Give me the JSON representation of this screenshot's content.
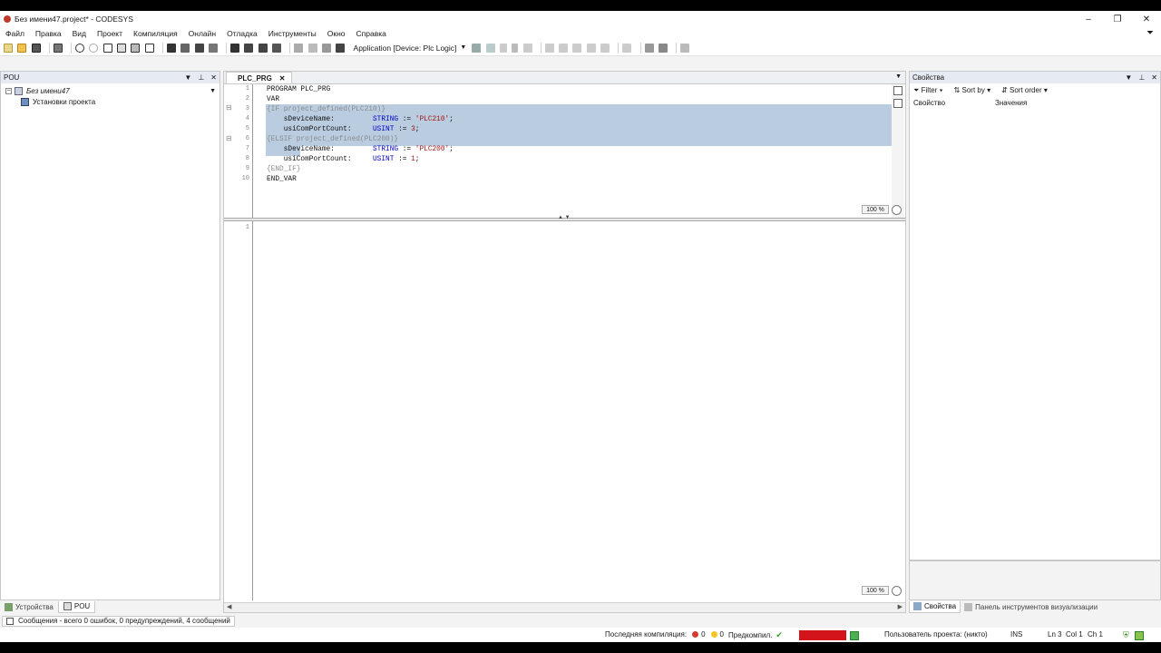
{
  "window": {
    "title": "Без имени47.project* - CODESYS",
    "controls": [
      "–",
      "❐",
      "✕"
    ]
  },
  "menu": [
    "Файл",
    "Правка",
    "Вид",
    "Проект",
    "Компиляция",
    "Онлайн",
    "Отладка",
    "Инструменты",
    "Окно",
    "Справка"
  ],
  "toolbar": {
    "application": "Application [Device: Plc Logic]"
  },
  "pou_panel": {
    "title": "POU",
    "tree": [
      {
        "label": "Без имени47",
        "italic": true
      },
      {
        "label": "Установки проекта",
        "italic": false
      }
    ],
    "tabs": [
      {
        "label": "Устройства",
        "active": false
      },
      {
        "label": "POU",
        "active": true
      }
    ]
  },
  "editor": {
    "tab_label": "PLC_PRG",
    "line_numbers": [
      "1",
      "2",
      "3",
      "4",
      "5",
      "6",
      "7",
      "8",
      "9",
      "10"
    ],
    "code": [
      {
        "num": "1",
        "parts": [
          {
            "t": "PROGRAM PLC_PRG",
            "c": "id"
          }
        ]
      },
      {
        "num": "2",
        "parts": [
          {
            "t": "VAR",
            "c": "id"
          }
        ]
      },
      {
        "num": "3",
        "parts": [
          {
            "t": "{IF project_defined(PLC210)}",
            "c": "pre"
          }
        ]
      },
      {
        "num": "4",
        "parts": [
          {
            "t": "    sDeviceName:         ",
            "c": "id"
          },
          {
            "t": "STRING",
            "c": "kw"
          },
          {
            "t": " := ",
            "c": "id"
          },
          {
            "t": "'PLC210'",
            "c": "str"
          },
          {
            "t": ";",
            "c": "id"
          }
        ]
      },
      {
        "num": "5",
        "parts": [
          {
            "t": "    usiComPortCount:     ",
            "c": "id"
          },
          {
            "t": "USINT",
            "c": "kw"
          },
          {
            "t": " := ",
            "c": "id"
          },
          {
            "t": "3",
            "c": "str"
          },
          {
            "t": ";",
            "c": "id"
          }
        ]
      },
      {
        "num": "6",
        "parts": [
          {
            "t": "{ELSIF project_defined(PLC200)}",
            "c": "pre"
          }
        ]
      },
      {
        "num": "7",
        "parts": [
          {
            "t": "    sDeviceName:         ",
            "c": "id"
          },
          {
            "t": "STRING",
            "c": "kw"
          },
          {
            "t": " := ",
            "c": "id"
          },
          {
            "t": "'PLC200'",
            "c": "str"
          },
          {
            "t": ";",
            "c": "id"
          }
        ]
      },
      {
        "num": "8",
        "parts": [
          {
            "t": "    usiComPortCount:     ",
            "c": "id"
          },
          {
            "t": "USINT",
            "c": "kw"
          },
          {
            "t": " := ",
            "c": "id"
          },
          {
            "t": "1",
            "c": "str"
          },
          {
            "t": ";",
            "c": "id"
          }
        ]
      },
      {
        "num": "9",
        "parts": [
          {
            "t": "{END_IF}",
            "c": "pre"
          }
        ]
      },
      {
        "num": "10",
        "parts": [
          {
            "t": "END_VAR",
            "c": "id"
          }
        ]
      }
    ],
    "decl_zoom": "100 %",
    "impl_line_numbers": [
      "1"
    ],
    "impl_zoom": "100 %"
  },
  "properties": {
    "title": "Свойства",
    "filter_label": "Filter",
    "sort_by_label": "Sort by",
    "sort_order_label": "Sort order",
    "col_property": "Свойство",
    "col_value": "Значения",
    "tabs": [
      {
        "label": "Свойства",
        "active": true
      },
      {
        "label": "Панель инструментов визуализации",
        "active": false
      }
    ]
  },
  "messages": {
    "summary": "Сообщения - всего 0 ошибок, 0 предупреждений, 4 сообщений"
  },
  "status": {
    "last_compile_label": "Последняя компиляция:",
    "errors": "0",
    "warnings": "0",
    "precompile_label": "Предкомпил.",
    "user_label": "Пользователь проекта: (никто)",
    "ins": "INS",
    "ln": "Ln 3",
    "col": "Col 1",
    "ch": "Ch 1"
  },
  "colors": {
    "selection": "#b9cce0",
    "keyword": "#0000c8",
    "string": "#a31515",
    "pragma": "#8c8c8c",
    "offline_badge": "#d3141a"
  }
}
